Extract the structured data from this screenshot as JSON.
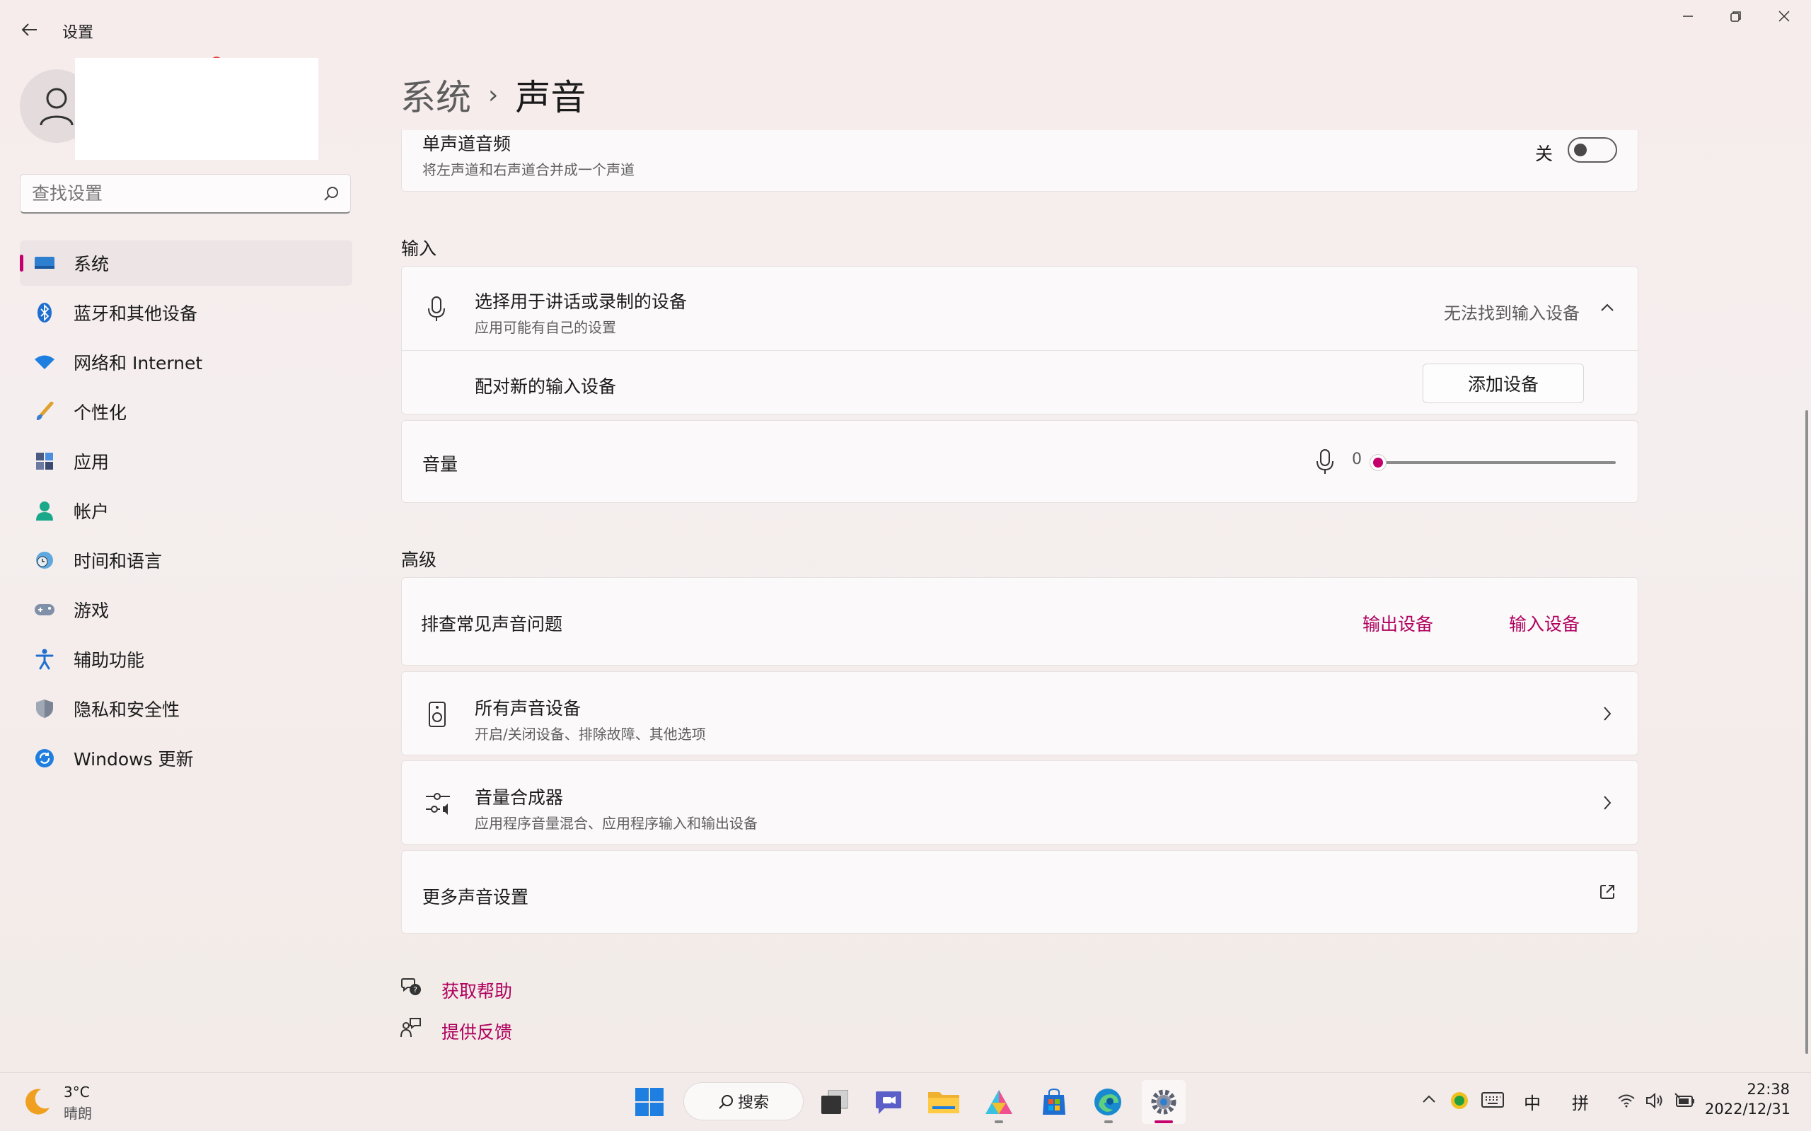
{
  "window": {
    "title": "设置"
  },
  "search": {
    "placeholder": "查找设置"
  },
  "nav": {
    "items": [
      {
        "label": "系统",
        "icon": "monitor-icon",
        "active": true
      },
      {
        "label": "蓝牙和其他设备",
        "icon": "bluetooth-icon"
      },
      {
        "label": "网络和 Internet",
        "icon": "wifi-icon"
      },
      {
        "label": "个性化",
        "icon": "brush-icon"
      },
      {
        "label": "应用",
        "icon": "apps-icon"
      },
      {
        "label": "帐户",
        "icon": "account-icon"
      },
      {
        "label": "时间和语言",
        "icon": "clock-globe-icon"
      },
      {
        "label": "游戏",
        "icon": "gamepad-icon"
      },
      {
        "label": "辅助功能",
        "icon": "accessibility-icon"
      },
      {
        "label": "隐私和安全性",
        "icon": "shield-icon"
      },
      {
        "label": "Windows 更新",
        "icon": "update-icon"
      }
    ]
  },
  "breadcrumb": {
    "parent": "系统",
    "separator": "›",
    "current": "声音"
  },
  "mono": {
    "title": "单声道音频",
    "subtitle": "将左声道和右声道合并成一个声道",
    "state_label": "关"
  },
  "input": {
    "section": "输入",
    "device": {
      "title": "选择用于讲话或录制的设备",
      "subtitle": "应用可能有自己的设置",
      "value": "无法找到输入设备"
    },
    "pair": {
      "label": "配对新的输入设备",
      "button": "添加设备"
    },
    "volume": {
      "label": "音量",
      "value": "0",
      "level_fraction": 0
    }
  },
  "advanced": {
    "section": "高级",
    "troubleshoot": {
      "label": "排查常见声音问题",
      "output_link": "输出设备",
      "input_link": "输入设备"
    },
    "all_devices": {
      "title": "所有声音设备",
      "subtitle": "开启/关闭设备、排除故障、其他选项"
    },
    "mixer": {
      "title": "音量合成器",
      "subtitle": "应用程序音量混合、应用程序输入和输出设备"
    },
    "more": {
      "label": "更多声音设置"
    }
  },
  "help": {
    "get_help": "获取帮助",
    "feedback": "提供反馈"
  },
  "taskbar": {
    "weather_temp": "3°C",
    "weather_desc": "晴朗",
    "search_label": "搜索",
    "ime_lang": "中",
    "ime_mode": "拼",
    "time": "22:38",
    "date": "2022/12/31"
  },
  "colors": {
    "accent": "#c3006b",
    "link": "#b0005e"
  }
}
